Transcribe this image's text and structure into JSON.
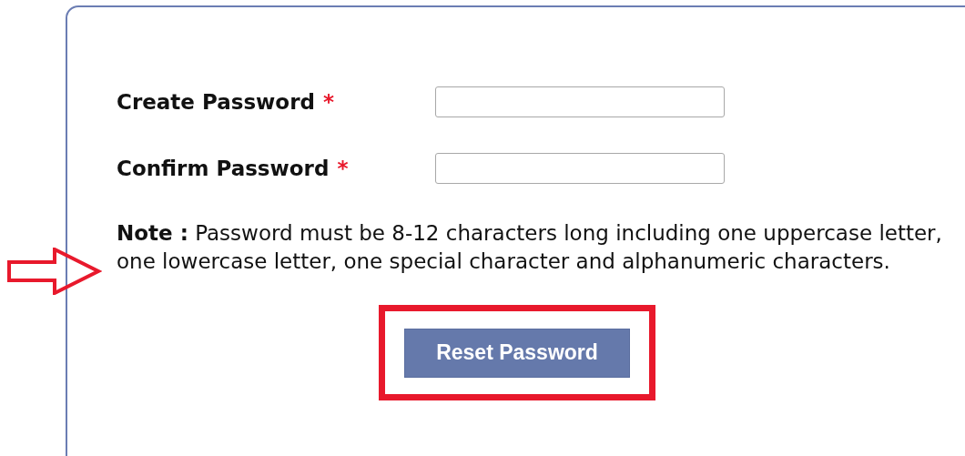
{
  "form": {
    "fields": [
      {
        "label": "Create Password",
        "required_mark": "*",
        "required": true
      },
      {
        "label": "Confirm Password",
        "required_mark": "*",
        "required": true
      }
    ],
    "note": "**Note :** Password must be 8-12 characters long including one uppercase letter, one lowercase letter, one special character and alphanumeric characters.",
    "submit_button": "Reset Password"
  },
  "annotations": {
    "note_arrow": true,
    "button_highlight": true
  }
}
